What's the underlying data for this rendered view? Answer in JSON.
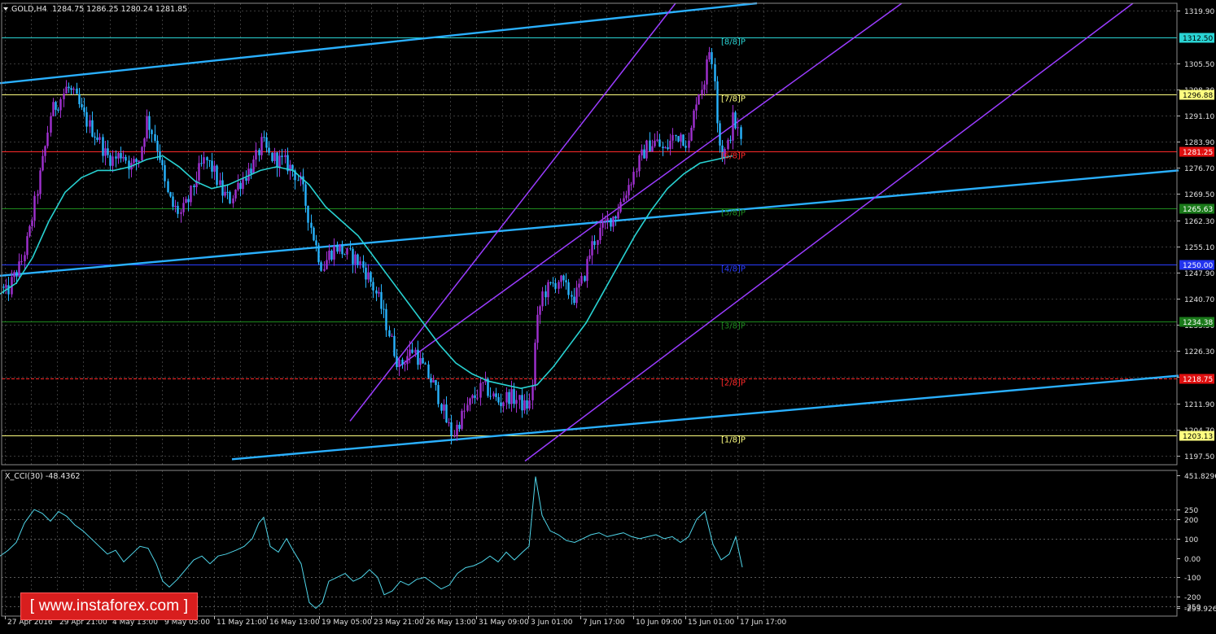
{
  "header": {
    "symbol_label": "GOLD,H4",
    "ohlc_label": "1284.75 1286.25 1280.24 1281.85",
    "indicator_label": "X_CCI(30) -48.4362"
  },
  "watermark": "[ www.instaforex.com ]",
  "colors": {
    "background": "#000000",
    "bull_candle": "#a030d0",
    "bear_candle": "#28b4ff",
    "moving_average": "#28d2d2",
    "channel_purple": "#9a3cff",
    "trend_cyan": "#2ab0ff",
    "cci_line": "#4fd6ea",
    "grid": "#3a3a3a"
  },
  "chart_data": [
    {
      "type": "candlestick",
      "title": "GOLD,H4",
      "ylim": [
        1195.0,
        1322.0
      ],
      "y_ticks": [
        1319.9,
        1305.5,
        1298.3,
        1291.1,
        1283.9,
        1276.7,
        1269.5,
        1262.3,
        1255.1,
        1247.9,
        1240.7,
        1233.5,
        1226.3,
        1219.1,
        1211.9,
        1204.7,
        1197.5
      ],
      "x_ticks": [
        "27 Apr 2016",
        "29 Apr 21:00",
        "4 May 13:00",
        "9 May 05:00",
        "11 May 21:00",
        "16 May 13:00",
        "19 May 05:00",
        "23 May 21:00",
        "26 May 13:00",
        "31 May 09:00",
        "3 Jun 01:00",
        "7 Jun 17:00",
        "10 Jun 09:00",
        "15 Jun 01:00",
        "17 Jun 17:00"
      ],
      "price_path": [
        [
          0,
          1244
        ],
        [
          8,
          1242
        ],
        [
          15,
          1246
        ],
        [
          25,
          1250
        ],
        [
          35,
          1258
        ],
        [
          45,
          1270
        ],
        [
          55,
          1282
        ],
        [
          62,
          1292
        ],
        [
          72,
          1295
        ],
        [
          82,
          1299
        ],
        [
          92,
          1296
        ],
        [
          100,
          1292
        ],
        [
          110,
          1288
        ],
        [
          120,
          1285
        ],
        [
          130,
          1280
        ],
        [
          140,
          1279
        ],
        [
          150,
          1281
        ],
        [
          160,
          1277
        ],
        [
          170,
          1279
        ],
        [
          180,
          1290
        ],
        [
          188,
          1286
        ],
        [
          196,
          1280
        ],
        [
          204,
          1270
        ],
        [
          212,
          1266
        ],
        [
          222,
          1264
        ],
        [
          232,
          1268
        ],
        [
          242,
          1275
        ],
        [
          252,
          1279
        ],
        [
          262,
          1276
        ],
        [
          272,
          1270
        ],
        [
          282,
          1268
        ],
        [
          292,
          1272
        ],
        [
          302,
          1275
        ],
        [
          312,
          1278
        ],
        [
          322,
          1284
        ],
        [
          330,
          1280
        ],
        [
          340,
          1279
        ],
        [
          350,
          1278
        ],
        [
          360,
          1276
        ],
        [
          370,
          1272
        ],
        [
          380,
          1262
        ],
        [
          388,
          1255
        ],
        [
          396,
          1249
        ],
        [
          404,
          1253
        ],
        [
          414,
          1255
        ],
        [
          424,
          1253
        ],
        [
          434,
          1252
        ],
        [
          444,
          1250
        ],
        [
          454,
          1246
        ],
        [
          464,
          1241
        ],
        [
          474,
          1234
        ],
        [
          482,
          1228
        ],
        [
          490,
          1222
        ],
        [
          500,
          1225
        ],
        [
          508,
          1227
        ],
        [
          516,
          1223
        ],
        [
          524,
          1220
        ],
        [
          532,
          1217
        ],
        [
          540,
          1213
        ],
        [
          548,
          1207
        ],
        [
          556,
          1203
        ],
        [
          564,
          1207
        ],
        [
          574,
          1211
        ],
        [
          584,
          1214
        ],
        [
          594,
          1217
        ],
        [
          604,
          1214
        ],
        [
          614,
          1212
        ],
        [
          624,
          1214
        ],
        [
          634,
          1213
        ],
        [
          644,
          1211
        ],
        [
          652,
          1212
        ],
        [
          658,
          1232
        ],
        [
          666,
          1242
        ],
        [
          676,
          1244
        ],
        [
          686,
          1246
        ],
        [
          696,
          1243
        ],
        [
          706,
          1241
        ],
        [
          716,
          1246
        ],
        [
          726,
          1255
        ],
        [
          736,
          1259
        ],
        [
          746,
          1262
        ],
        [
          756,
          1264
        ],
        [
          766,
          1269
        ],
        [
          776,
          1274
        ],
        [
          786,
          1279
        ],
        [
          796,
          1283
        ],
        [
          806,
          1284
        ],
        [
          816,
          1281
        ],
        [
          826,
          1285
        ],
        [
          836,
          1286
        ],
        [
          846,
          1283
        ],
        [
          856,
          1297
        ],
        [
          864,
          1300
        ],
        [
          872,
          1310
        ],
        [
          878,
          1302
        ],
        [
          882,
          1285
        ],
        [
          888,
          1280
        ],
        [
          894,
          1283
        ],
        [
          900,
          1290
        ],
        [
          906,
          1287
        ],
        [
          912,
          1282
        ]
      ],
      "moving_average": [
        [
          0,
          1242
        ],
        [
          20,
          1245
        ],
        [
          40,
          1252
        ],
        [
          60,
          1262
        ],
        [
          80,
          1270
        ],
        [
          100,
          1274
        ],
        [
          120,
          1276
        ],
        [
          140,
          1276
        ],
        [
          160,
          1277
        ],
        [
          180,
          1279
        ],
        [
          200,
          1280
        ],
        [
          220,
          1277
        ],
        [
          240,
          1273
        ],
        [
          260,
          1271
        ],
        [
          280,
          1272
        ],
        [
          300,
          1274
        ],
        [
          320,
          1276
        ],
        [
          340,
          1277
        ],
        [
          360,
          1276
        ],
        [
          380,
          1272
        ],
        [
          400,
          1266
        ],
        [
          420,
          1262
        ],
        [
          440,
          1258
        ],
        [
          460,
          1252
        ],
        [
          480,
          1246
        ],
        [
          500,
          1240
        ],
        [
          520,
          1234
        ],
        [
          540,
          1228
        ],
        [
          560,
          1223
        ],
        [
          580,
          1220
        ],
        [
          600,
          1218
        ],
        [
          620,
          1217
        ],
        [
          640,
          1216
        ],
        [
          660,
          1217
        ],
        [
          680,
          1222
        ],
        [
          700,
          1228
        ],
        [
          720,
          1234
        ],
        [
          740,
          1242
        ],
        [
          760,
          1250
        ],
        [
          780,
          1258
        ],
        [
          800,
          1265
        ],
        [
          820,
          1271
        ],
        [
          840,
          1275
        ],
        [
          860,
          1278
        ],
        [
          880,
          1279
        ],
        [
          900,
          1280
        ]
      ],
      "horizontal_levels": [
        {
          "price": 1312.5,
          "label": "[8/8]P",
          "tag": "1312.50",
          "color": "#2ad4d4",
          "tag_bg": "#2ad4d4",
          "tag_fg": "#000000",
          "style": "solid"
        },
        {
          "price": 1296.88,
          "label": "[7/8]P",
          "tag": "1296.88",
          "color": "#ffff80",
          "tag_bg": "#ffff80",
          "tag_fg": "#000000",
          "style": "solid"
        },
        {
          "price": 1281.25,
          "label": "[6/8]P",
          "tag": "1281.25",
          "color": "#ff2a2a",
          "tag_bg": "#e01010",
          "tag_fg": "#ffffff",
          "style": "solid"
        },
        {
          "price": 1265.63,
          "label": "[5/8]P",
          "tag": "1265.63",
          "color": "#1e8a1e",
          "tag_bg": "#1a7a1a",
          "tag_fg": "#ffffff",
          "style": "solid"
        },
        {
          "price": 1250.0,
          "label": "[4/8]P",
          "tag": "1250.00",
          "color": "#2a3cff",
          "tag_bg": "#2233ee",
          "tag_fg": "#ffffff",
          "style": "solid"
        },
        {
          "price": 1234.38,
          "label": "[3/8]P",
          "tag": "1234.38",
          "color": "#1e8a1e",
          "tag_bg": "#1a7a1a",
          "tag_fg": "#ffffff",
          "style": "solid"
        },
        {
          "price": 1218.75,
          "label": "[2/8]P",
          "tag": "1218.75",
          "color": "#ff2a2a",
          "tag_bg": "#e01010",
          "tag_fg": "#ffffff",
          "style": "dashed"
        },
        {
          "price": 1203.13,
          "label": "[1/8]P",
          "tag": "1203.13",
          "color": "#ffff80",
          "tag_bg": "#ffff80",
          "tag_fg": "#000000",
          "style": "solid"
        }
      ],
      "trend_lines": [
        {
          "name": "cyan-upper",
          "color": "#2ab0ff",
          "p1": [
            0,
            1300.0
          ],
          "p2": [
            930,
            1322.0
          ]
        },
        {
          "name": "cyan-middle",
          "color": "#2ab0ff",
          "p1": [
            0,
            1247.0
          ],
          "p2": [
            1448,
            1276.0
          ]
        },
        {
          "name": "cyan-lower",
          "color": "#2ab0ff",
          "p1": [
            285,
            1196.5
          ],
          "p2": [
            1448,
            1219.5
          ]
        },
        {
          "name": "purple-top",
          "color": "#9a3cff",
          "p1": [
            430,
            1207.0
          ],
          "p2": [
            830,
            1322.0
          ]
        },
        {
          "name": "purple-mid",
          "color": "#9a3cff",
          "p1": [
            490,
            1222.0
          ],
          "p2": [
            1108,
            1322.0
          ]
        },
        {
          "name": "purple-bottom",
          "color": "#9a3cff",
          "p1": [
            645,
            1196.0
          ],
          "p2": [
            1392,
            1322.0
          ]
        }
      ]
    },
    {
      "type": "line",
      "title": "X_CCI(30) -48.4362",
      "ylim": [
        -300,
        452
      ],
      "y_ticks": [
        {
          "value": 451.8296,
          "label": "451.8296"
        },
        {
          "value": 250,
          "label": "250"
        },
        {
          "value": 200,
          "label": "200"
        },
        {
          "value": 100,
          "label": "100"
        },
        {
          "value": 0,
          "label": "0.00"
        },
        {
          "value": -100,
          "label": "-100"
        },
        {
          "value": -200,
          "label": "-200"
        },
        {
          "value": -250,
          "label": "-250"
        },
        {
          "value": -293.9265,
          "label": "-293.9265"
        }
      ],
      "levels": [
        250,
        200,
        100,
        -100,
        -200,
        -250
      ],
      "values": [
        [
          0,
          10
        ],
        [
          10,
          40
        ],
        [
          20,
          80
        ],
        [
          30,
          180
        ],
        [
          42,
          250
        ],
        [
          52,
          230
        ],
        [
          62,
          190
        ],
        [
          72,
          240
        ],
        [
          82,
          215
        ],
        [
          92,
          170
        ],
        [
          102,
          140
        ],
        [
          112,
          100
        ],
        [
          122,
          60
        ],
        [
          132,
          20
        ],
        [
          142,
          40
        ],
        [
          152,
          -20
        ],
        [
          162,
          20
        ],
        [
          172,
          60
        ],
        [
          182,
          50
        ],
        [
          192,
          -30
        ],
        [
          200,
          -120
        ],
        [
          208,
          -150
        ],
        [
          218,
          -110
        ],
        [
          228,
          -60
        ],
        [
          238,
          -10
        ],
        [
          248,
          10
        ],
        [
          258,
          -30
        ],
        [
          268,
          10
        ],
        [
          278,
          20
        ],
        [
          290,
          40
        ],
        [
          300,
          60
        ],
        [
          310,
          100
        ],
        [
          318,
          180
        ],
        [
          324,
          210
        ],
        [
          332,
          60
        ],
        [
          342,
          30
        ],
        [
          352,
          100
        ],
        [
          360,
          40
        ],
        [
          370,
          -30
        ],
        [
          380,
          -230
        ],
        [
          388,
          -260
        ],
        [
          396,
          -230
        ],
        [
          404,
          -120
        ],
        [
          414,
          -100
        ],
        [
          424,
          -80
        ],
        [
          434,
          -120
        ],
        [
          444,
          -100
        ],
        [
          454,
          -60
        ],
        [
          464,
          -100
        ],
        [
          472,
          -190
        ],
        [
          482,
          -170
        ],
        [
          492,
          -120
        ],
        [
          502,
          -140
        ],
        [
          512,
          -110
        ],
        [
          522,
          -100
        ],
        [
          532,
          -130
        ],
        [
          542,
          -160
        ],
        [
          552,
          -140
        ],
        [
          562,
          -80
        ],
        [
          572,
          -50
        ],
        [
          582,
          -40
        ],
        [
          592,
          -20
        ],
        [
          602,
          10
        ],
        [
          612,
          -20
        ],
        [
          622,
          30
        ],
        [
          632,
          -10
        ],
        [
          642,
          30
        ],
        [
          650,
          60
        ],
        [
          658,
          420
        ],
        [
          666,
          220
        ],
        [
          676,
          140
        ],
        [
          686,
          120
        ],
        [
          696,
          90
        ],
        [
          706,
          80
        ],
        [
          716,
          100
        ],
        [
          726,
          120
        ],
        [
          736,
          130
        ],
        [
          746,
          110
        ],
        [
          756,
          120
        ],
        [
          766,
          130
        ],
        [
          776,
          110
        ],
        [
          786,
          100
        ],
        [
          796,
          110
        ],
        [
          806,
          120
        ],
        [
          816,
          100
        ],
        [
          826,
          110
        ],
        [
          836,
          80
        ],
        [
          846,
          110
        ],
        [
          856,
          200
        ],
        [
          866,
          240
        ],
        [
          876,
          70
        ],
        [
          886,
          -10
        ],
        [
          896,
          20
        ],
        [
          904,
          110
        ],
        [
          912,
          -48
        ]
      ]
    }
  ]
}
